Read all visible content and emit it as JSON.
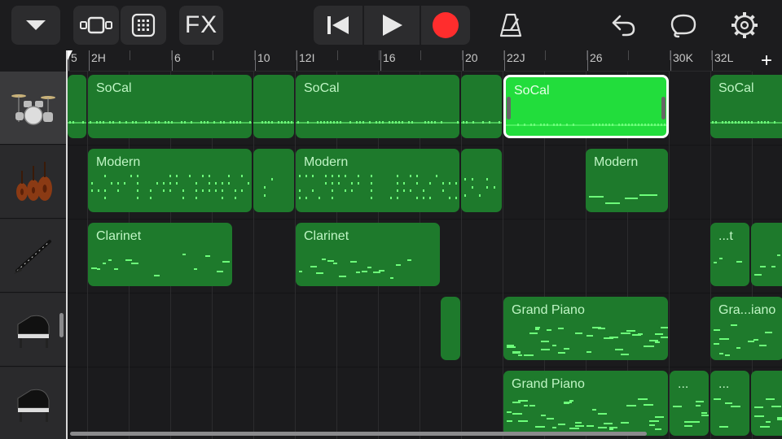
{
  "toolbar": {
    "fx_label": "FX",
    "buttons": [
      {
        "name": "browser-dropdown-button",
        "icon": "chevron-down-icon"
      },
      {
        "name": "tracks-view-button",
        "icon": "tracks-view-icon"
      },
      {
        "name": "grid-view-button",
        "icon": "grid-icon"
      },
      {
        "name": "fx-button",
        "icon": "fx-icon"
      },
      {
        "name": "go-to-beginning-button",
        "icon": "skip-back-icon"
      },
      {
        "name": "play-button",
        "icon": "play-icon"
      },
      {
        "name": "record-button",
        "icon": "record-icon"
      },
      {
        "name": "metronome-button",
        "icon": "metronome-icon"
      },
      {
        "name": "undo-button",
        "icon": "undo-icon"
      },
      {
        "name": "loop-browser-button",
        "icon": "loop-icon"
      },
      {
        "name": "settings-button",
        "icon": "gear-icon"
      }
    ]
  },
  "ruler": {
    "labels": [
      "5",
      "2H",
      "6",
      "10",
      "12I",
      "16",
      "20",
      "22J",
      "26",
      "30K",
      "32L"
    ],
    "add_label": "+"
  },
  "tracks": [
    {
      "id": "drums",
      "instrument_icon": "drum-kit-icon",
      "selected": true
    },
    {
      "id": "strings",
      "instrument_icon": "violin-icon",
      "selected": false
    },
    {
      "id": "clarinet",
      "instrument_icon": "clarinet-icon",
      "selected": false
    },
    {
      "id": "piano-1",
      "instrument_icon": "grand-piano-icon",
      "selected": false
    },
    {
      "id": "piano-2",
      "instrument_icon": "grand-piano-icon",
      "selected": false
    }
  ],
  "regions": {
    "drums": [
      "",
      "SoCal",
      "",
      "SoCal",
      "",
      "SoCal",
      "SoCal"
    ],
    "strings": [
      "Modern",
      "",
      "Modern",
      "",
      "Modern"
    ],
    "clarinet": [
      "Clarinet",
      "Clarinet",
      "...t",
      ""
    ],
    "piano1": [
      "",
      "Grand Piano",
      "Gra...iano",
      ""
    ],
    "piano2": [
      "Grand Piano",
      "...",
      "...",
      ""
    ]
  },
  "colors": {
    "region": "#1e7a2c",
    "region_selected": "#22dd3c",
    "record": "#ff2d2d",
    "note": "#6dff7a"
  }
}
